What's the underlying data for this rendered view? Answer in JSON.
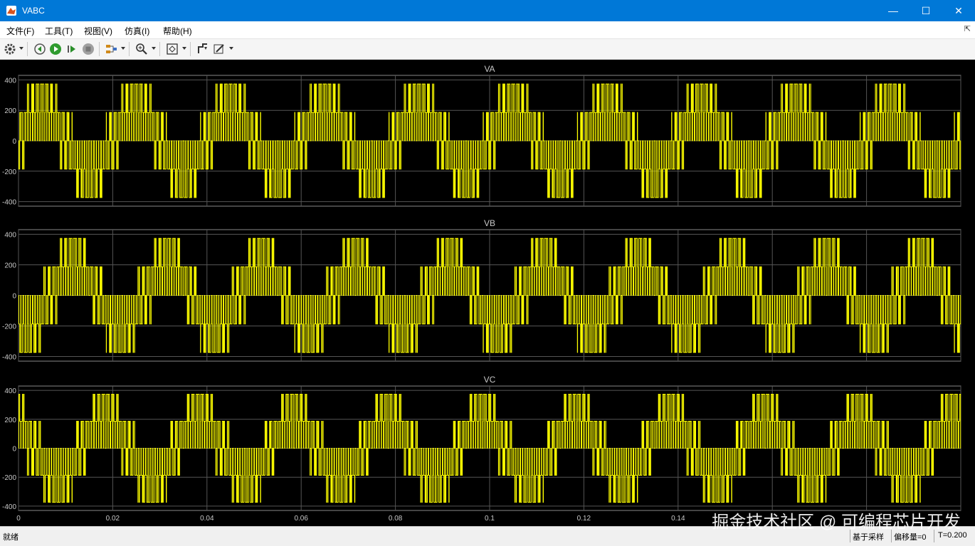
{
  "window": {
    "title": "VABC"
  },
  "menu": {
    "items": [
      "文件(F)",
      "工具(T)",
      "视图(V)",
      "仿真(I)",
      "帮助(H)"
    ]
  },
  "toolbar": {
    "icons": [
      "gear-icon",
      "step-back-icon",
      "run-icon",
      "step-forward-icon",
      "stop-icon",
      "highlight-icon",
      "zoom-icon",
      "fit-icon",
      "cursor-measure-icon",
      "style-icon"
    ]
  },
  "colors": {
    "accent": "#0078d7",
    "signal": "#ffff00",
    "plot_bg": "#000000",
    "axes_bg": "#202020",
    "grid": "#555555"
  },
  "chart_data": [
    {
      "type": "line",
      "title": "VA",
      "xlim": [
        0,
        0.2
      ],
      "ylim": [
        -430,
        430
      ],
      "yticks": [
        400,
        200,
        0,
        -200,
        -400
      ],
      "yticklabels": [
        "400",
        "200",
        "0",
        "-200",
        "-400"
      ],
      "grid": true,
      "series": [
        {
          "values": "PWM phase-voltage pulses, levels ±187 and ±373 V, ~50 Hz envelope, start phase 0"
        }
      ]
    },
    {
      "type": "line",
      "title": "VB",
      "xlim": [
        0,
        0.2
      ],
      "ylim": [
        -430,
        430
      ],
      "yticks": [
        400,
        200,
        0,
        -200,
        -400
      ],
      "yticklabels": [
        "400",
        "200",
        "0",
        "-200",
        "-400"
      ],
      "grid": true,
      "series": [
        {
          "values": "PWM phase-voltage pulses, levels ±187 and ±373 V, phase -120°"
        }
      ]
    },
    {
      "type": "line",
      "title": "VC",
      "xlim": [
        0,
        0.2
      ],
      "ylim": [
        -430,
        430
      ],
      "yticks": [
        400,
        200,
        0,
        -200,
        -400
      ],
      "yticklabels": [
        "400",
        "200",
        "0",
        "-200",
        "-400"
      ],
      "xticks": [
        0,
        0.02,
        0.04,
        0.06,
        0.08,
        0.1,
        0.12,
        0.14
      ],
      "xticklabels": [
        "0",
        "0.02",
        "0.04",
        "0.06",
        "0.08",
        "0.1",
        "0.12",
        "0.14"
      ],
      "grid": true,
      "series": [
        {
          "values": "PWM phase-voltage pulses, levels ±187 and ±373 V, phase +120°"
        }
      ]
    }
  ],
  "status": {
    "text": "就绪",
    "mode": "基于采样",
    "offset": "偏移量=0",
    "time": "T=0.200"
  },
  "watermark": {
    "text": "掘金技术社区 @ 可编程芯片开发"
  }
}
